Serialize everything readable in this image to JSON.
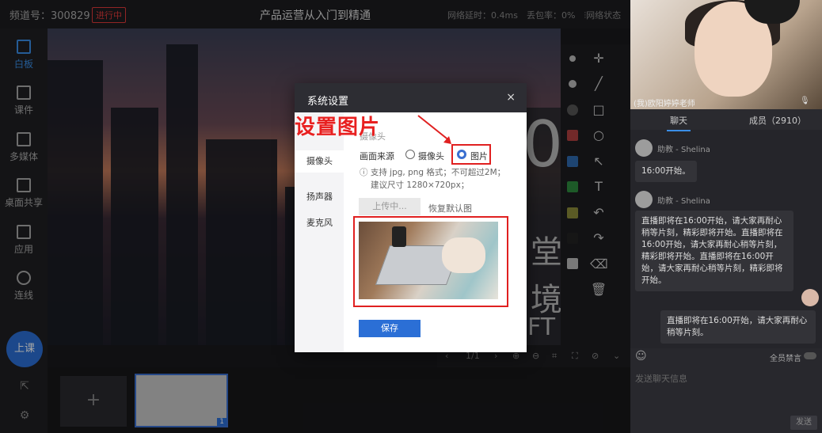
{
  "header": {
    "channel": "频道号：300829",
    "status": "进行中",
    "title": "产品运营从入门到精通",
    "latency": "网络延时：0.4ms",
    "packet_loss": "丢包率：0%",
    "network_state": "网络状态"
  },
  "sidebar": {
    "items": [
      {
        "label": "白板",
        "icon": "whiteboard-icon"
      },
      {
        "label": "课件",
        "icon": "courseware-icon"
      },
      {
        "label": "多媒体",
        "icon": "media-icon"
      },
      {
        "label": "桌面共享",
        "icon": "screen-share-icon"
      },
      {
        "label": "应用",
        "icon": "apps-icon"
      },
      {
        "label": "连线",
        "icon": "phone-icon"
      }
    ],
    "start_label": "上课"
  },
  "stage": {
    "big_chars": [
      "0",
      "堂",
      "境",
      "FT"
    ]
  },
  "pagebar": {
    "page": "1/1"
  },
  "thumbs": {
    "add": "+",
    "num": "1"
  },
  "video": {
    "name": "(我)欧阳婷婷老师"
  },
  "chat": {
    "tab_chat": "聊天",
    "tab_members": "成员（2910）",
    "messages": [
      {
        "user": "助教 - Shelina",
        "text": "16:00开始。"
      },
      {
        "user": "助教 - Shelina",
        "text": "直播即将在16:00开始，请大家再耐心稍等片刻，精彩即将开始。直播即将在16:00开始，请大家再耐心稍等片刻，精彩即将开始。直播即将在16:00开始，请大家再耐心稍等片刻，精彩即将开始。"
      },
      {
        "user": "",
        "text": "直播即将在16:00开始，请大家再耐心稍等片刻。"
      }
    ],
    "mute_all": "全员禁言",
    "placeholder": "发送聊天信息",
    "send": "发送"
  },
  "dialog": {
    "title": "系统设置",
    "close": "×",
    "nav": [
      "摄像头",
      "扬声器",
      "麦克风"
    ],
    "section": "摄像头",
    "source_label": "画面来源",
    "opt_camera": "摄像头",
    "opt_image": "图片",
    "hint1": "支持 jpg, png 格式；不可超过2M；",
    "hint2": "建议尺寸 1280×720px；",
    "upload": "上传中...",
    "restore": "恢复默认图",
    "save": "保存"
  },
  "annotation": {
    "text": "设置图片",
    "color": "#e82020"
  }
}
